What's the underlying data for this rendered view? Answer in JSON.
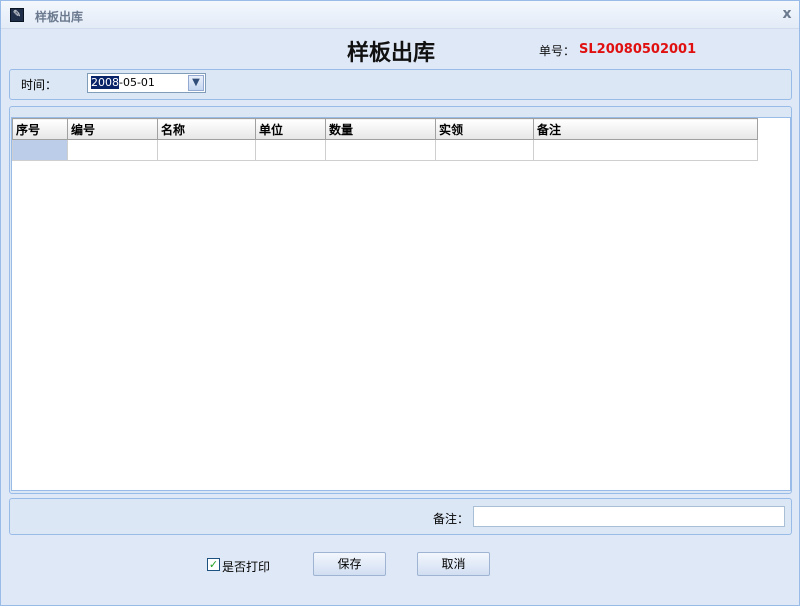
{
  "window": {
    "title": "样板出库",
    "close_glyph": "x"
  },
  "header": {
    "title": "样板出库",
    "order_label": "单号：",
    "order_no": "SL20080502001"
  },
  "filter": {
    "time_label": "时间：",
    "date_selected": "2008",
    "date_rest": "-05-01"
  },
  "grid": {
    "columns": [
      "序号",
      "编号",
      "名称",
      "单位",
      "数量",
      "实领",
      "备注"
    ]
  },
  "footer": {
    "remark_label": "备注：",
    "remark_value": "",
    "print_checkbox": {
      "label": "是否打印",
      "checked": true,
      "glyph": "✓"
    },
    "save_label": "保存",
    "cancel_label": "取消"
  }
}
